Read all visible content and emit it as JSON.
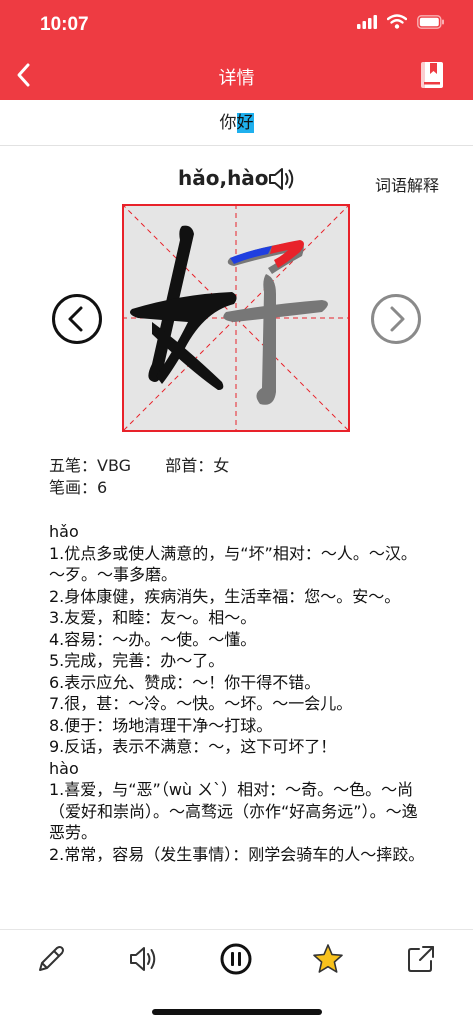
{
  "status": {
    "time": "10:07"
  },
  "nav": {
    "title": "详情",
    "back_icon": "chevron-left-icon",
    "book_icon": "bookmark-book-icon"
  },
  "word": {
    "prefix": "你",
    "highlight": "好"
  },
  "pinyin": {
    "text": "hǎo,hào",
    "speaker_icon": "speaker-icon"
  },
  "word_explain_label": "词语解释",
  "character": {
    "glyph": "好",
    "stroke_highlight_color": "#1f3fe0",
    "stroke_current_color": "#e8222a",
    "grid_color": "#e8222a"
  },
  "info": {
    "wubi_label": "五笔：",
    "wubi_value": "VBG",
    "radical_label": "部首：",
    "radical_value": "女",
    "strokes_label": "笔画：",
    "strokes_value": "6"
  },
  "definitions": [
    "hǎo",
    "1.优点多或使人满意的，与“坏”相对：～人。～汉。～歹。～事多磨。",
    "2.身体康健，疾病消失，生活幸福：您～。安～。",
    "3.友爱，和睦：友～。相～。",
    "4.容易：～办。～使。～懂。",
    "5.完成，完善：办～了。",
    "6.表示应允、赞成：～！你干得不错。",
    "7.很，甚：～冷。～快。～坏。～一会儿。",
    "8.便于：场地清理干净～打球。",
    "9.反话，表示不满意：～，这下可坏了！",
    "hào",
    "1.喜爱，与“恶”（wù ㄨˋ）相对：～奇。～色。～尚（爱好和崇尚）。～高骛远（亦作“好高务远”）。～逸恶劳。",
    "2.常常，容易（发生事情）：刚学会骑车的人～摔跤。"
  ],
  "colors": {
    "accent": "#ee3b42"
  }
}
